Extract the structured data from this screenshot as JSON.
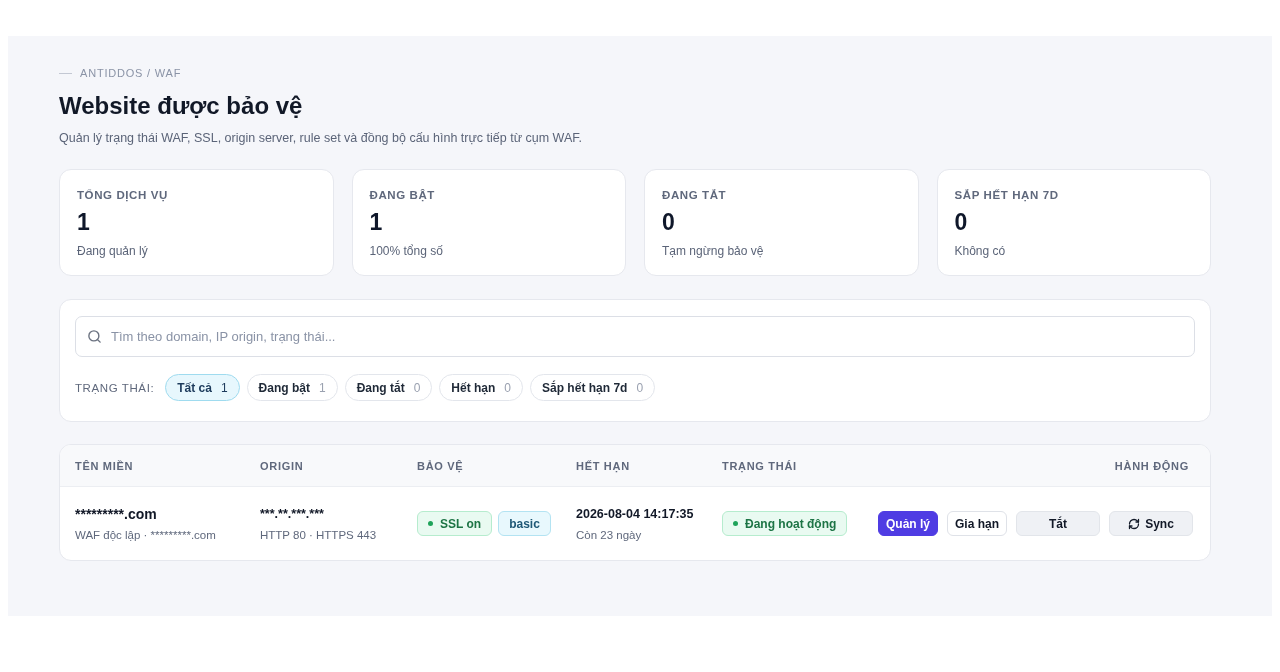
{
  "breadcrumb": "ANTIDDOS / WAF",
  "title": "Website được bảo vệ",
  "subtitle": "Quản lý trạng thái WAF, SSL, origin server, rule set và đồng bộ cấu hình trực tiếp từ cụm WAF.",
  "stats": [
    {
      "label": "TỔNG DỊCH VỤ",
      "value": "1",
      "note": "Đang quản lý"
    },
    {
      "label": "ĐANG BẬT",
      "value": "1",
      "note": "100% tổng số"
    },
    {
      "label": "ĐANG TẮT",
      "value": "0",
      "note": "Tạm ngừng bảo vệ"
    },
    {
      "label": "SẮP HẾT HẠN 7D",
      "value": "0",
      "note": "Không có"
    }
  ],
  "search": {
    "placeholder": "Tìm theo domain, IP origin, trạng thái..."
  },
  "filters": {
    "label": "TRẠNG THÁI:",
    "chips": [
      {
        "label": "Tất cả",
        "count": "1",
        "selected": true
      },
      {
        "label": "Đang bật",
        "count": "1",
        "selected": false
      },
      {
        "label": "Đang tắt",
        "count": "0",
        "selected": false
      },
      {
        "label": "Hết hạn",
        "count": "0",
        "selected": false
      },
      {
        "label": "Sắp hết hạn 7d",
        "count": "0",
        "selected": false
      }
    ]
  },
  "table": {
    "columns": [
      "TÊN MIỀN",
      "ORIGIN",
      "BẢO VỆ",
      "HẾT HẠN",
      "TRẠNG THÁI",
      "HÀNH ĐỘNG"
    ],
    "rows": [
      {
        "domain": "*********.com",
        "domain_note": "WAF độc lập · *********.com",
        "origin": "***.**.***.***",
        "origin_note": "HTTP 80 · HTTPS 443",
        "protection": [
          {
            "label": "SSL on",
            "kind": "success"
          },
          {
            "label": "basic",
            "kind": "info"
          }
        ],
        "expires": "2026-08-04 14:17:35",
        "expires_note": "Còn 23 ngày",
        "status": {
          "label": "Đang hoạt động",
          "kind": "success"
        },
        "actions": [
          {
            "label": "Quản lý",
            "kind": "primary"
          },
          {
            "label": "Gia hạn",
            "kind": "outline"
          },
          {
            "label": "Tắt",
            "kind": "muted"
          },
          {
            "label": "Sync",
            "kind": "sync"
          }
        ]
      }
    ]
  }
}
